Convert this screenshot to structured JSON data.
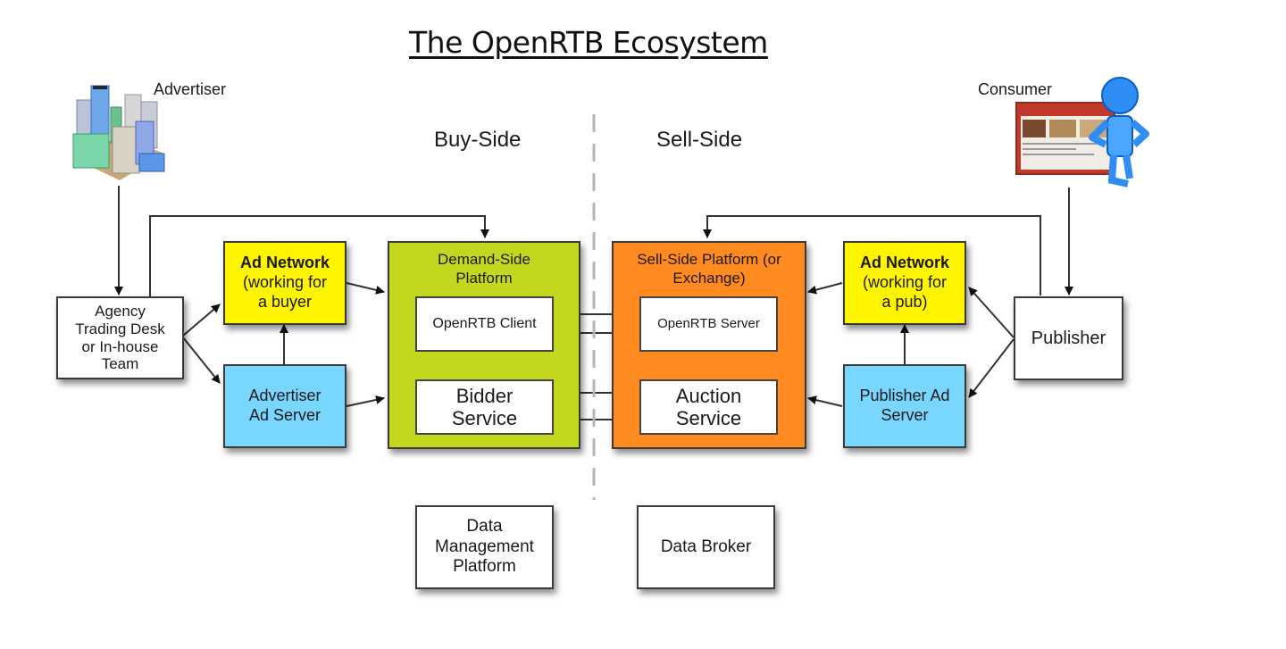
{
  "title": "The OpenRTB Ecosystem",
  "sides": {
    "buy": "Buy-Side",
    "sell": "Sell-Side"
  },
  "actors": {
    "advertiser": "Advertiser",
    "consumer": "Consumer"
  },
  "nodes": {
    "agency": [
      "Agency",
      "Trading Desk",
      "or In-house",
      "Team"
    ],
    "ad_network_buyer": {
      "title": "Ad Network",
      "lines": [
        "(working for",
        "a buyer"
      ]
    },
    "advertiser_ad_server": [
      "Advertiser",
      "Ad Server"
    ],
    "dsp": {
      "title": [
        "Demand-Side",
        "Platform"
      ],
      "client": "OpenRTB Client",
      "bidder": [
        "Bidder",
        "Service"
      ]
    },
    "ssp": {
      "title": [
        "Sell-Side Platform (or",
        "Exchange)"
      ],
      "server": "OpenRTB Server",
      "auction": [
        "Auction",
        "Service"
      ]
    },
    "ad_network_pub": {
      "title": "Ad Network",
      "lines": [
        "(working for",
        "a pub)"
      ]
    },
    "publisher_ad_server": [
      "Publisher Ad",
      "Server"
    ],
    "publisher": "Publisher",
    "dmp": [
      "Data",
      "Management",
      "Platform"
    ],
    "data_broker": "Data Broker"
  },
  "colors": {
    "yellow": "#fff500",
    "blue": "#79d6ff",
    "green": "#c3d71f",
    "orange": "#ff8a1f"
  }
}
